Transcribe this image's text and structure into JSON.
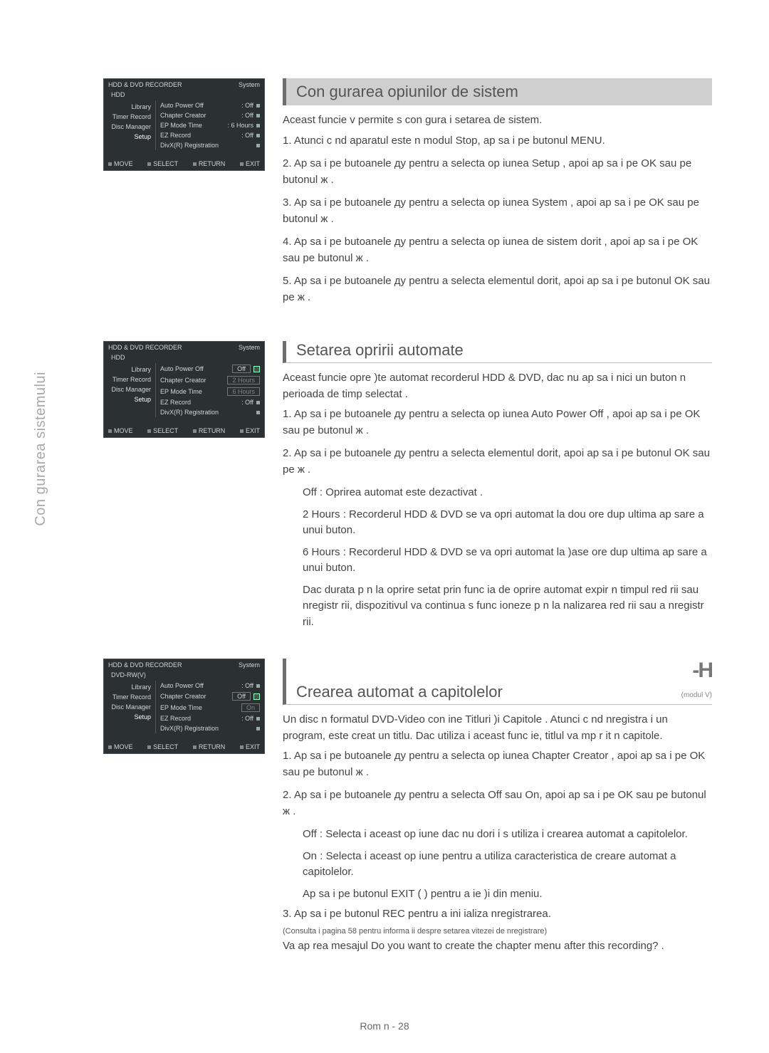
{
  "side_label": "Con gurarea\nsistemului",
  "panel1": {
    "title": "HDD & DVD RECORDER",
    "corner": "System",
    "disk": "HDD",
    "menu": [
      "Library",
      "Timer Record",
      "Disc Manager",
      "Setup"
    ],
    "items": [
      {
        "k": "Auto Power Off",
        "v": ": Off",
        "mark": "dot"
      },
      {
        "k": "Chapter Creator",
        "v": ": Off",
        "mark": "dot"
      },
      {
        "k": "EP Mode Time",
        "v": ": 6 Hours",
        "mark": "dot"
      },
      {
        "k": "EZ Record",
        "v": ": Off",
        "mark": "dot"
      },
      {
        "k": "DivX(R) Registration",
        "v": "",
        "mark": "dot"
      }
    ],
    "ft": [
      "MOVE",
      "SELECT",
      "RETURN",
      "EXIT"
    ]
  },
  "panel2": {
    "title": "HDD & DVD RECORDER",
    "corner": "System",
    "disk": "HDD",
    "menu": [
      "Library",
      "Timer Record",
      "Disc Manager",
      "Setup"
    ],
    "items": [
      {
        "k": "Auto Power Off",
        "v": "Off",
        "mark": "check",
        "drop": true
      },
      {
        "k": "Chapter Creator",
        "v": "2 Hours",
        "mark": "",
        "muted": true
      },
      {
        "k": "EP Mode Time",
        "v": "6 Hours",
        "mark": "",
        "muted": true
      },
      {
        "k": "EZ Record",
        "v": ": Off",
        "mark": "dot"
      },
      {
        "k": "DivX(R) Registration",
        "v": "",
        "mark": "dot"
      }
    ],
    "ft": [
      "MOVE",
      "SELECT",
      "RETURN",
      "EXIT"
    ]
  },
  "panel3": {
    "title": "HDD & DVD RECORDER",
    "corner": "System",
    "disk": "DVD-RW(V)",
    "menu": [
      "Library",
      "Timer Record",
      "Disc Manager",
      "Setup"
    ],
    "items": [
      {
        "k": "Auto Power Off",
        "v": ": Off",
        "mark": "dot"
      },
      {
        "k": "Chapter Creator",
        "v": "Off",
        "mark": "check",
        "drop": true
      },
      {
        "k": "EP Mode Time",
        "v": "On",
        "mark": "",
        "muted": true
      },
      {
        "k": "EZ Record",
        "v": ": Off",
        "mark": "dot"
      },
      {
        "k": "DivX(R) Registration",
        "v": "",
        "mark": "dot"
      }
    ],
    "ft": [
      "MOVE",
      "SELECT",
      "RETURN",
      "EXIT"
    ]
  },
  "sec1": {
    "title": "Con gurarea opiunilor de sistem",
    "intro": "Aceast funcie v permite s con gura i setarea de sistem.",
    "steps": [
      "Atunci c nd aparatul este n modul Stop, ap sa i pe butonul MENU.",
      "Ap sa i pe butoanele ду pentru a selecta op iunea Setup , apoi ap sa i pe OK sau pe butonul ж .",
      "Ap sa i pe butoanele ду pentru a selecta op iunea System , apoi ap sa i pe OK sau pe butonul ж .",
      "Ap sa i pe butoanele ду pentru a selecta op iunea de sistem dorit , apoi ap sa i pe OK sau pe butonul ж .",
      "Ap sa i pe butoanele ду pentru a selecta elementul dorit, apoi ap sa i pe butonul OK sau pe ж ."
    ]
  },
  "sec2": {
    "title": "Setarea opririi automate",
    "intro": "Aceast funcie opre )te automat recorderul HDD & DVD, dac nu ap sa i nici un buton n perioada de timp selectat .",
    "steps": [
      "Ap sa i pe butoanele ду pentru a selecta op iunea Auto Power Off , apoi ap sa i pe OK sau pe butonul ж .",
      "Ap sa i pe butoanele ду pentru a selecta elementul dorit, apoi ap sa i pe butonul OK sau pe ж ."
    ],
    "bullets": [
      "Off : Oprirea automat este dezactivat .",
      "2 Hours : Recorderul HDD & DVD se va opri automat la dou ore dup ultima ap sare a unui buton.",
      "6 Hours : Recorderul HDD & DVD se va opri automat la )ase ore dup ultima ap sare a unui buton."
    ],
    "note": "Dac durata p n la oprire setat prin func ia de oprire automat expir n timpul red rii sau nregistr rii, dispozitivul va continua s func ioneze p n la nalizarea red rii sau a nregistr rii."
  },
  "sec3": {
    "title": "Crearea automat a capitolelor",
    "disc": "-H",
    "disc_sub": "(modul V)",
    "intro": "Un disc n formatul DVD-Video con ine Titluri )i Capitole . Atunci c nd nregistra i un program, este creat un titlu. Dac utiliza i aceast func ie, titlul va mp r it n capitole.",
    "steps": [
      "Ap sa i pe butoanele ду pentru a selecta op iunea Chapter Creator , apoi ap sa i pe OK sau pe butonul ж .",
      "Ap sa i pe butoanele ду pentru a selecta Off sau On, apoi ap sa i pe OK sau pe butonul ж ."
    ],
    "bullets": [
      "Off : Selecta i aceast op iune dac nu dori i s utiliza i crearea automat a capitolelor.",
      "On : Selecta i aceast op iune pentru a utiliza caracteristica de creare automat a capitolelor."
    ],
    "exit": "Ap sa i pe butonul EXIT ( ) pentru a ie )i din meniu.",
    "step3": "Ap sa i pe butonul REC pentru a ini ializa nregistrarea.",
    "step3a": "(Consulta i pagina 58 pentru informa ii despre setarea vitezei de nregistrare)",
    "step3b": "Va ap rea mesajul Do you want to create the chapter menu after this recording? ."
  },
  "footer": "Rom n - 28"
}
